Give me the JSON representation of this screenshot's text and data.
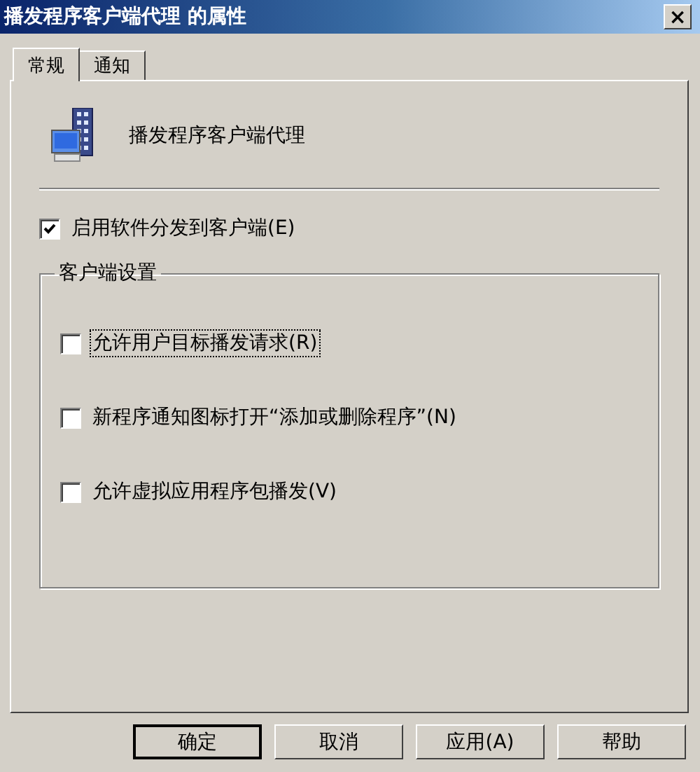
{
  "window": {
    "title": "播发程序客户端代理 的属性",
    "close": "×"
  },
  "tabs": [
    {
      "label": "常规",
      "selected": true
    },
    {
      "label": "通知",
      "selected": false
    }
  ],
  "header": {
    "name": "播发程序客户端代理"
  },
  "enable": {
    "label": "启用软件分发到客户端(E)",
    "checked": true
  },
  "group": {
    "title": "客户端设置",
    "options": [
      {
        "label": "允许用户目标播发请求(R)",
        "checked": false,
        "focused": true
      },
      {
        "label": "新程序通知图标打开“添加或删除程序”(N)",
        "checked": false,
        "focused": false
      },
      {
        "label": "允许虚拟应用程序包播发(V)",
        "checked": false,
        "focused": false
      }
    ]
  },
  "buttons": [
    {
      "label": "确定",
      "default": true
    },
    {
      "label": "取消",
      "default": false
    },
    {
      "label": "应用(A)",
      "default": false
    },
    {
      "label": "帮助",
      "default": false
    }
  ]
}
